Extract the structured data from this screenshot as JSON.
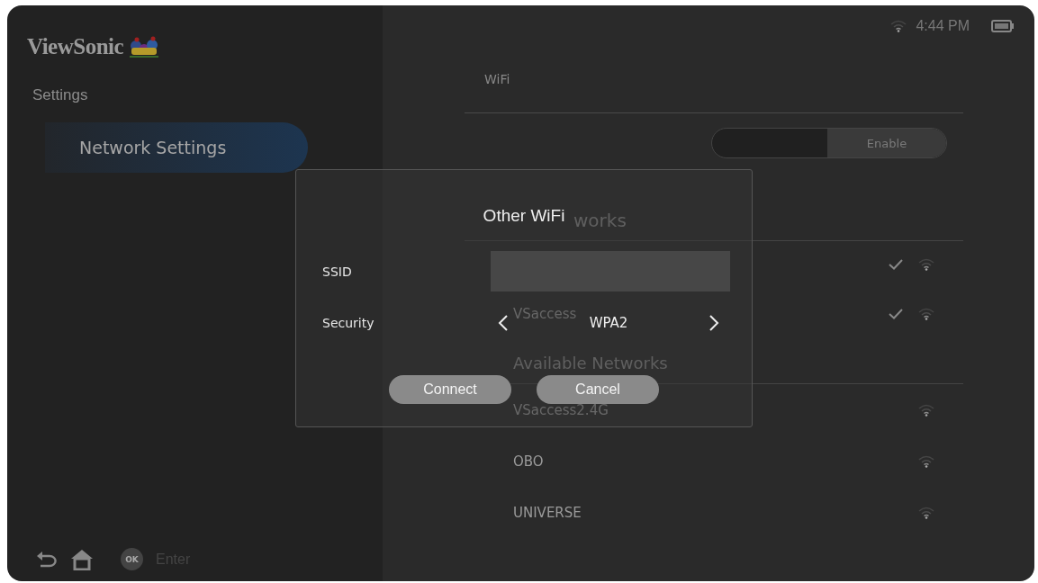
{
  "header": {
    "brand": "ViewSonic",
    "time": "4:44 PM"
  },
  "sidebar": {
    "title": "Settings",
    "items": [
      {
        "label": "Network Settings",
        "selected": true
      }
    ]
  },
  "footer_hints": {
    "ok_badge": "OK",
    "label": "Enter"
  },
  "wifi": {
    "title": "WiFi",
    "toggle": {
      "label": "Enable",
      "on": true
    },
    "sections": [
      {
        "title": "works",
        "networks": [
          {
            "connected": true
          },
          {
            "name": "VSaccess",
            "connected": true
          }
        ]
      },
      {
        "title": "Available Networks",
        "networks": [
          {
            "name": "VSaccess2.4G",
            "connected": false
          },
          {
            "name": "OBO",
            "connected": false
          },
          {
            "name": "UNIVERSE",
            "connected": false
          }
        ]
      }
    ]
  },
  "dialog": {
    "title": "Other WiFi",
    "fields": [
      {
        "kind": "text",
        "label": "SSID"
      },
      {
        "kind": "selector",
        "label": "Security",
        "value": "WPA2"
      }
    ],
    "buttons": [
      "Connect",
      "Cancel"
    ]
  }
}
